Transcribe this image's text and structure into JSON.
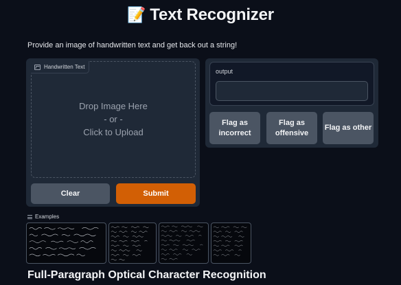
{
  "page": {
    "title_emoji": "📝",
    "title": "Text Recognizer",
    "description": "Provide an image of handwritten text and get back out a string!",
    "subtitle": "Full-Paragraph Optical Character Recognition"
  },
  "input": {
    "label": "Handwritten Text",
    "label_icon": "image-icon",
    "drop_line1": "Drop Image Here",
    "drop_line2": "- or -",
    "drop_line3": "Click to Upload"
  },
  "buttons": {
    "clear": "Clear",
    "submit": "Submit"
  },
  "output": {
    "label": "output",
    "value": ""
  },
  "flags": [
    {
      "label": "Flag as incorrect"
    },
    {
      "label": "Flag as offensive"
    },
    {
      "label": "Flag as other"
    }
  ],
  "examples": {
    "label": "Examples",
    "icon": "list-icon",
    "count": 4
  },
  "colors": {
    "background": "#0b0f19",
    "panel": "#1f2937",
    "submit": "#d25f05",
    "secondary_button": "#4b5563"
  }
}
